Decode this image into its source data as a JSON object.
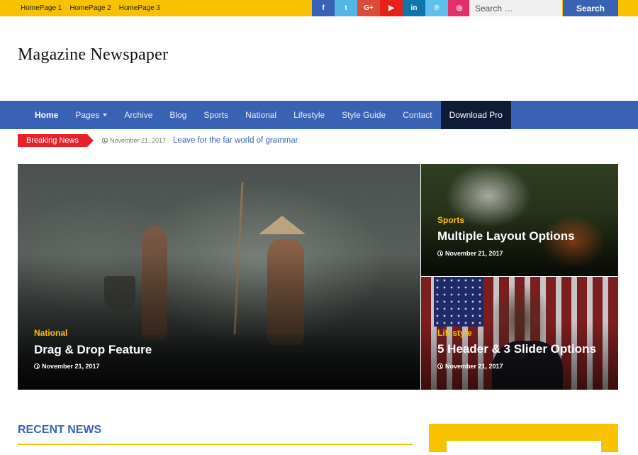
{
  "top_links": [
    "HomePage 1",
    "HomePage 2",
    "HomePage 3"
  ],
  "social": [
    {
      "name": "facebook-icon",
      "glyph": "f",
      "color": "#3a62b4"
    },
    {
      "name": "twitter-icon",
      "glyph": "t",
      "color": "#52b6e8"
    },
    {
      "name": "google-plus-icon",
      "glyph": "G+",
      "color": "#dd4b39"
    },
    {
      "name": "youtube-icon",
      "glyph": "▶",
      "color": "#e62117"
    },
    {
      "name": "linkedin-icon",
      "glyph": "in",
      "color": "#0e76a8"
    },
    {
      "name": "pinterest-icon",
      "glyph": "℗",
      "color": "#5bc0eb"
    },
    {
      "name": "instagram-icon",
      "glyph": "◎",
      "color": "#e1306c"
    }
  ],
  "search": {
    "placeholder": "Search …",
    "button": "Search"
  },
  "site_title": "Magazine Newspaper",
  "nav": [
    {
      "label": "Home",
      "active": true
    },
    {
      "label": "Pages",
      "dropdown": true
    },
    {
      "label": "Archive"
    },
    {
      "label": "Blog"
    },
    {
      "label": "Sports"
    },
    {
      "label": "National"
    },
    {
      "label": "Lifestyle"
    },
    {
      "label": "Style Guide"
    },
    {
      "label": "Contact"
    },
    {
      "label": "Download Pro",
      "highlight": true
    }
  ],
  "breaking": {
    "tag": "Breaking News",
    "date": "November 21, 2017",
    "headline": "Leave for the far world of grammar"
  },
  "features": [
    {
      "category": "National",
      "title": "Drag & Drop Feature",
      "date": "November 21, 2017"
    },
    {
      "category": "Sports",
      "title": "Multiple Layout Options",
      "date": "November 21, 2017"
    },
    {
      "category": "Lifestyle",
      "title": "5 Header & 3 Slider Options",
      "date": "November 21, 2017"
    }
  ],
  "recent_news_title": "RECENT NEWS",
  "colors": {
    "accent_yellow": "#f9c200",
    "brand_blue": "#3a62b4",
    "breaking_red": "#e8202a",
    "nav_pro": "#0f1b36"
  }
}
